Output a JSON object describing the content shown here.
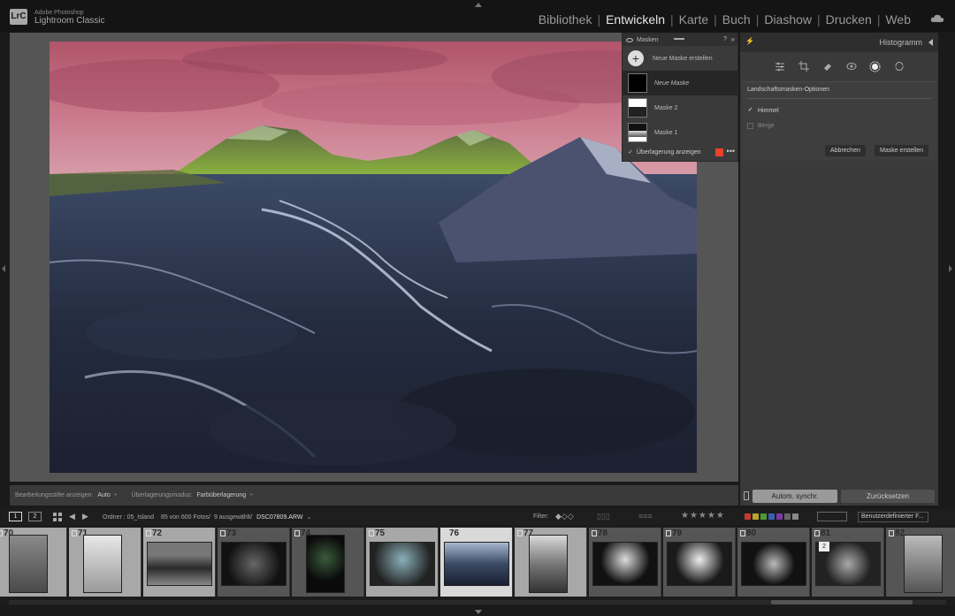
{
  "app": {
    "logo": "LrC",
    "vendor": "Adobe Photoshop",
    "name": "Lightroom Classic"
  },
  "modules": [
    {
      "label": "Bibliothek",
      "active": false
    },
    {
      "label": "Entwickeln",
      "active": true
    },
    {
      "label": "Karte",
      "active": false
    },
    {
      "label": "Buch",
      "active": false
    },
    {
      "label": "Diashow",
      "active": false
    },
    {
      "label": "Drucken",
      "active": false
    },
    {
      "label": "Web",
      "active": false
    }
  ],
  "masks_panel": {
    "title": "Masken",
    "help": "?",
    "new_mask_button": "Neue Maske erstellen",
    "items": [
      {
        "label": "Neue Maske",
        "active": true
      },
      {
        "label": "Maske 2",
        "active": false
      },
      {
        "label": "Maske 1",
        "active": false
      }
    ],
    "show_overlay": "Überlagerung anzeigen",
    "overlay_checkmark": "✓",
    "overlay_color": "#e8432a",
    "more": "•••"
  },
  "right_panel": {
    "histogram_title": "Histogramm",
    "tools": [
      "sliders-icon",
      "crop-icon",
      "eraser-icon",
      "redeye-icon",
      "masking-icon",
      "reset-icon"
    ],
    "landscape": {
      "title": "Landschaftsmasken-Optionen",
      "options": [
        {
          "label": "Himmel",
          "checked": true
        },
        {
          "label": "Berge",
          "checked": false
        }
      ],
      "checkmark": "✓",
      "cancel": "Abbrechen",
      "create": "Maske erstellen"
    },
    "sync_button": "Autom. synchr.",
    "reset_button": "Zurücksetzen"
  },
  "toolbar": {
    "edit_pins_label": "Bearbeitungsstifte anzeigen:",
    "edit_pins_value": "Auto",
    "overlay_mode_label": "Überlagerungsmodus:",
    "overlay_mode_value": "Farbüberlagerung"
  },
  "film_nav": {
    "page1": "1",
    "page2": "2",
    "folder": "Ordner : 05_Island",
    "count": "85 von 600 Fotos/",
    "selected": "9 ausgewählt/",
    "file": "DSC07809.ARW",
    "filter_label": "Filter:",
    "stars": "★★★★★",
    "preset": "Benutzerdefinierter F...",
    "color_labels": [
      "#c23a2e",
      "#b8a32e",
      "#4e9a3a",
      "#3a5fb0",
      "#7a3aa0",
      "#666666",
      "#888888"
    ]
  },
  "filmstrip": [
    {
      "num": "70",
      "state": "sel"
    },
    {
      "num": "71",
      "state": "sel"
    },
    {
      "num": "72",
      "state": "sel"
    },
    {
      "num": "73",
      "state": "normal"
    },
    {
      "num": "74",
      "state": "normal"
    },
    {
      "num": "75",
      "state": "sel"
    },
    {
      "num": "76",
      "state": "cur"
    },
    {
      "num": "77",
      "state": "sel"
    },
    {
      "num": "78",
      "state": "normal"
    },
    {
      "num": "79",
      "state": "normal"
    },
    {
      "num": "80",
      "state": "normal"
    },
    {
      "num": "81",
      "state": "normal",
      "badge": "2"
    },
    {
      "num": "82",
      "state": "normal"
    }
  ]
}
